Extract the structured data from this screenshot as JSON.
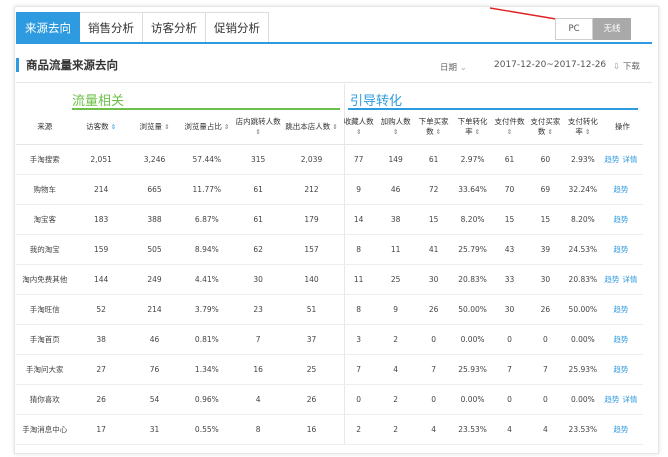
{
  "tabs": [
    "来源去向",
    "销售分析",
    "访客分析",
    "促销分析"
  ],
  "device_toggle": {
    "pc": "PC",
    "wireless": "无线"
  },
  "section_title": "商品流量来源去向",
  "date_select": "日期",
  "date_range": "2017-12-20~2017-12-26",
  "download_label": "下载",
  "groups": {
    "traffic": "流量相关",
    "guide": "引导转化"
  },
  "columns": [
    "来源",
    "访客数",
    "浏览量",
    "浏览量占比",
    "店内跳转人数",
    "跳出本店人数",
    "收藏人数",
    "加购人数",
    "下单买家数",
    "下单转化率",
    "支付件数",
    "支付买家数",
    "支付转化率",
    "操作"
  ],
  "rows": [
    {
      "src": "手淘搜索",
      "v": [
        "2,051",
        "3,246",
        "57.44%",
        "315",
        "2,039",
        "77",
        "149",
        "61",
        "2.97%",
        "61",
        "60",
        "2.93%"
      ],
      "op": [
        "趋势",
        "详情"
      ]
    },
    {
      "src": "购物车",
      "v": [
        "214",
        "665",
        "11.77%",
        "61",
        "212",
        "9",
        "46",
        "72",
        "33.64%",
        "70",
        "69",
        "32.24%"
      ],
      "op": [
        "趋势"
      ]
    },
    {
      "src": "淘宝客",
      "v": [
        "183",
        "388",
        "6.87%",
        "61",
        "179",
        "14",
        "38",
        "15",
        "8.20%",
        "15",
        "15",
        "8.20%"
      ],
      "op": [
        "趋势"
      ]
    },
    {
      "src": "我的淘宝",
      "v": [
        "159",
        "505",
        "8.94%",
        "62",
        "157",
        "8",
        "11",
        "41",
        "25.79%",
        "43",
        "39",
        "24.53%"
      ],
      "op": [
        "趋势"
      ]
    },
    {
      "src": "淘内免费其他",
      "v": [
        "144",
        "249",
        "4.41%",
        "30",
        "140",
        "11",
        "25",
        "30",
        "20.83%",
        "33",
        "30",
        "20.83%"
      ],
      "op": [
        "趋势",
        "详情"
      ]
    },
    {
      "src": "手淘旺信",
      "v": [
        "52",
        "214",
        "3.79%",
        "23",
        "51",
        "8",
        "9",
        "26",
        "50.00%",
        "30",
        "26",
        "50.00%"
      ],
      "op": [
        "趋势"
      ]
    },
    {
      "src": "手淘首页",
      "v": [
        "38",
        "46",
        "0.81%",
        "7",
        "37",
        "3",
        "2",
        "0",
        "0.00%",
        "0",
        "0",
        "0.00%"
      ],
      "op": [
        "趋势"
      ]
    },
    {
      "src": "手淘问大家",
      "v": [
        "27",
        "76",
        "1.34%",
        "16",
        "25",
        "7",
        "4",
        "7",
        "25.93%",
        "7",
        "7",
        "25.93%"
      ],
      "op": [
        "趋势"
      ]
    },
    {
      "src": "猜你喜欢",
      "v": [
        "26",
        "54",
        "0.96%",
        "4",
        "26",
        "0",
        "2",
        "0",
        "0.00%",
        "0",
        "0",
        "0.00%"
      ],
      "op": [
        "趋势",
        "详情"
      ]
    },
    {
      "src": "手淘消息中心",
      "v": [
        "17",
        "31",
        "0.55%",
        "8",
        "16",
        "2",
        "2",
        "4",
        "23.53%",
        "4",
        "4",
        "23.53%"
      ],
      "op": [
        "趋势"
      ]
    }
  ],
  "colors": {
    "accent": "#2e9be0",
    "green": "#6cc04a"
  }
}
